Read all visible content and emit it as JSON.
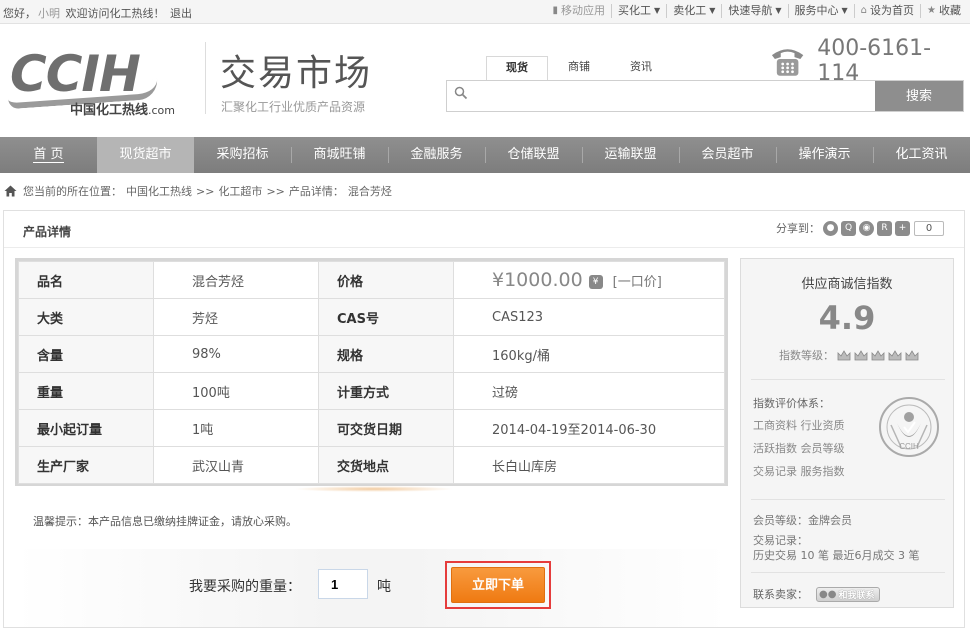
{
  "topbar": {
    "greeting": "您好，",
    "username": "小明",
    "welcome": "欢迎访问化工热线！",
    "logout": "退出",
    "links": [
      {
        "label": "移动应用",
        "muted": true
      },
      {
        "label": "买化工",
        "caret": true
      },
      {
        "label": "卖化工",
        "caret": true
      },
      {
        "label": "快速导航",
        "caret": true
      },
      {
        "label": "服务中心",
        "caret": true
      },
      {
        "label": "设为首页"
      },
      {
        "label": "收藏"
      }
    ]
  },
  "header": {
    "logo_text": "CCIH",
    "logo_sub": "中国化工热线",
    "logo_domain": ".com",
    "title": "交易市场",
    "slogan": "汇聚化工行业优质产品资源",
    "phone": "400-6161-114"
  },
  "search": {
    "tabs": [
      "现货",
      "商铺",
      "资讯"
    ],
    "active_tab": 0,
    "placeholder": "",
    "button": "搜索"
  },
  "nav": {
    "items": [
      "首 页",
      "现货超市",
      "采购招标",
      "商城旺铺",
      "金融服务",
      "仓储联盟",
      "运输联盟",
      "会员超市",
      "操作演示",
      "化工资讯"
    ],
    "active": 1
  },
  "breadcrumb": {
    "prefix": "您当前的所在位置：",
    "items": [
      "中国化工热线",
      ">>",
      "化工超市",
      ">>",
      "产品详情：",
      "混合芳烃"
    ]
  },
  "panel": {
    "title": "产品详情",
    "share_label": "分享到：",
    "share_count": "0"
  },
  "product": {
    "name_k": "品名",
    "name_v": "混合芳烃",
    "price_k": "价格",
    "price_v": "¥1000.00",
    "price_type": "[一口价]",
    "cat_k": "大类",
    "cat_v": "芳烃",
    "cas_k": "CAS号",
    "cas_v": "CAS123",
    "content_k": "含量",
    "content_v": "98%",
    "spec_k": "规格",
    "spec_v": "160kg/桶",
    "weight_k": "重量",
    "weight_v": "100吨",
    "measure_k": "计重方式",
    "measure_v": "过磅",
    "min_k": "最小起订量",
    "min_v": "1吨",
    "date_k": "可交货日期",
    "date_v": "2014-04-19至2014-06-30",
    "maker_k": "生产厂家",
    "maker_v": "武汉山青",
    "place_k": "交货地点",
    "place_v": "长白山库房"
  },
  "tip": "温馨提示：本产品信息已缴纳挂牌证金，请放心采购。",
  "order": {
    "label": "我要采购的重量：",
    "qty": "1",
    "unit": "吨",
    "button": "立即下单"
  },
  "supplier": {
    "title": "供应商诚信指数",
    "score": "4.9",
    "level_label": "指数等级：",
    "level_count": 5,
    "eval_title": "指数评价体系：",
    "eval_items": [
      "工商资料 行业资质",
      "活跃指数 会员等级",
      "交易记录 服务指数"
    ],
    "seal_text": "CCIH",
    "member": "会员等级：金牌会员",
    "record_label": "交易记录：",
    "record": "历史交易 10 笔 最近6月成交 3 笔",
    "contact_label": "联系卖家：",
    "contact_button": "和我联系"
  },
  "colors": {
    "nav_bg": "#8a8a8a",
    "nav_active": "#b5b5b5",
    "order_btn": "#f18a24",
    "highlight_frame": "#e53c3c"
  }
}
